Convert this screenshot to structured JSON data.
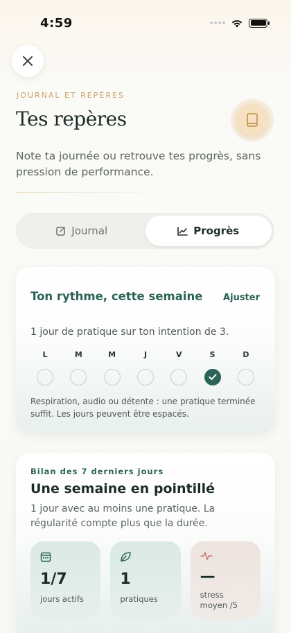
{
  "status_bar": {
    "time": "4:59"
  },
  "header": {
    "eyebrow": "JOURNAL ET REPÈRES",
    "title": "Tes repères",
    "subtitle": "Note ta journée ou retrouve tes progrès, sans pression de performance."
  },
  "tabs": [
    {
      "label": "Journal",
      "icon": "edit-icon",
      "active": false
    },
    {
      "label": "Progrès",
      "icon": "chart-line-icon",
      "active": true
    }
  ],
  "rhythm_card": {
    "title": "Ton rythme, cette semaine",
    "adjust_label": "Ajuster",
    "summary": "1 jour de pratique sur ton intention de 3.",
    "days": [
      {
        "label": "L",
        "done": false
      },
      {
        "label": "M",
        "done": false
      },
      {
        "label": "M",
        "done": false
      },
      {
        "label": "J",
        "done": false
      },
      {
        "label": "V",
        "done": false
      },
      {
        "label": "S",
        "done": true
      },
      {
        "label": "D",
        "done": false
      }
    ],
    "note": "Respiration, audio ou détente : une pratique terminée suffit. Les jours peuvent être espacés."
  },
  "summary_card": {
    "eyebrow": "Bilan des 7 derniers jours",
    "title": "Une semaine en pointillé",
    "description": "1 jour avec au moins une pratique. La régularité compte plus que la durée.",
    "stats": [
      {
        "value": "1/7",
        "label": "jours actifs",
        "icon": "calendar-icon"
      },
      {
        "value": "1",
        "label": "pratiques",
        "icon": "leaf-icon"
      },
      {
        "value": "—",
        "label": "stress moyen /5",
        "icon": "heartbeat-icon"
      }
    ]
  },
  "colors": {
    "accent": "#2b6358",
    "gold": "#c9a46a",
    "warn": "#c9786a"
  }
}
